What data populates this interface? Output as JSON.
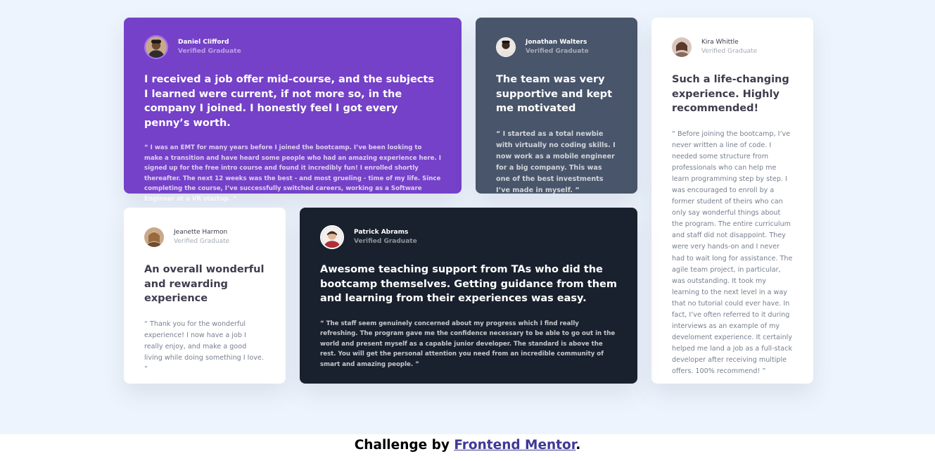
{
  "colors": {
    "background": "#edf4fd",
    "purple": "#7541c8",
    "slate": "#48556a",
    "white": "#ffffff",
    "dark": "#19212e",
    "link": "#3e3996"
  },
  "testimonials": [
    {
      "name": "Daniel Clifford",
      "role": "Verified Graduate",
      "avatar": "avatar-daniel-icon",
      "headline": "I received a job offer mid-course, and the subjects I learned were current, if not more so, in the company I joined. I honestly feel I got every penny’s worth.",
      "quote": "“ I was an EMT for many years before I joined the bootcamp. I’ve been looking to make a transition and have heard some people who had an amazing experience here. I signed up for the free intro course and found it incredibly fun! I enrolled shortly thereafter. The next 12 weeks was the best - and most grueling - time of my life. Since completing the course, I’ve successfully switched careers, working as a Software Engineer at a VR startup. ”"
    },
    {
      "name": "Jonathan Walters",
      "role": "Verified Graduate",
      "avatar": "avatar-jonathan-icon",
      "headline": "The team was very supportive and kept me motivated",
      "quote": "“ I started as a total newbie with virtually no coding skills. I now work as a mobile engineer for a big company. This was one of the best investments I’ve made in myself. ”"
    },
    {
      "name": "Kira Whittle",
      "role": "Verified Graduate",
      "avatar": "avatar-kira-icon",
      "headline": "Such a life-changing experience. Highly recommended!",
      "quote": "“ Before joining the bootcamp, I’ve never written a line of code. I needed some structure from professionals who can help me learn programming step by step. I was encouraged to enroll by a former student of theirs who can only say wonderful things about the program. The entire curriculum and staff did not disappoint. They were very hands-on and I never had to wait long for assistance. The agile team project, in particular, was outstanding. It took my learning to the next level in a way that no tutorial could ever have. In fact, I’ve often referred to it during interviews as an example of my develoment experience. It certainly helped me land a job as a full-stack developer after receiving multiple offers. 100% recommend! ”"
    },
    {
      "name": "Jeanette Harmon",
      "role": "Verified Graduate",
      "avatar": "avatar-jeanette-icon",
      "headline": "An overall wonderful and rewarding experience",
      "quote": "“ Thank you for the wonderful experience! I now have a job I really enjoy, and make a good living while doing something I love. ”"
    },
    {
      "name": "Patrick Abrams",
      "role": "Verified Graduate",
      "avatar": "avatar-patrick-icon",
      "headline": "Awesome teaching support from TAs who did the bootcamp themselves. Getting guidance from them and learning from their experiences was easy.",
      "quote": "“ The staff seem genuinely concerned about my progress which I find really refreshing. The program gave me the confidence necessary to be able to go out in the world and present myself as a capable junior developer. The standard is above the rest. You will get the personal attention you need from an incredible community of smart and amazing people. ”"
    }
  ],
  "footer": {
    "prefix": "Challenge by ",
    "link": "Frontend Mentor",
    "suffix": "."
  }
}
